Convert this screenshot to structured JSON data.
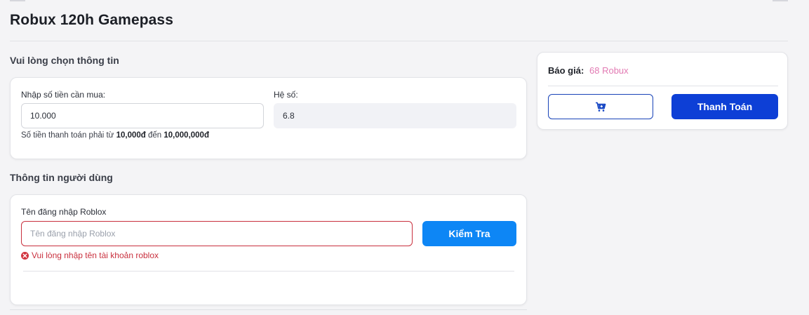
{
  "page": {
    "title": "Robux 120h Gamepass"
  },
  "info_section": {
    "heading": "Vui lòng chọn thông tin",
    "amount_label": "Nhập số tiền cần mua:",
    "amount_value": "10.000",
    "rate_label": "Hệ số:",
    "rate_value": "6.8",
    "hint_prefix": "Số tiền thanh toán phải từ",
    "hint_min": "10,000đ",
    "hint_mid": "đến",
    "hint_max": "10,000,000đ"
  },
  "user_section": {
    "heading": "Thông tin người dùng",
    "username_label": "Tên đăng nhập Roblox",
    "username_value": "",
    "username_placeholder": "Tên đăng nhập Roblox",
    "check_button": "Kiểm Tra",
    "error_message": "Vui lòng nhập tên tài khoản roblox"
  },
  "summary": {
    "price_label": "Báo giá:",
    "price_value": "68 Robux",
    "pay_button": "Thanh Toán",
    "cart_icon": "cart-plus-icon"
  },
  "colors": {
    "primary": "#0d3fd6",
    "check_button": "#0d86f5",
    "price": "#e27ab3",
    "error": "#c9303e"
  }
}
